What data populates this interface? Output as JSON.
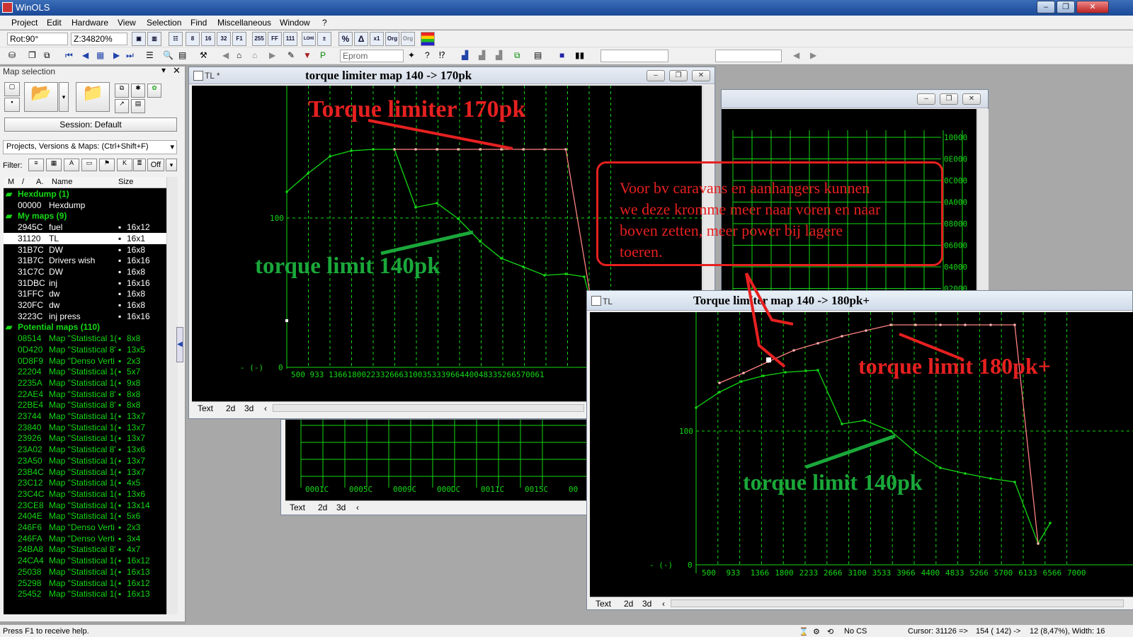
{
  "app": {
    "title": "WinOLS"
  },
  "menu": [
    "Project",
    "Edit",
    "Hardware",
    "View",
    "Selection",
    "Find",
    "Miscellaneous",
    "Window",
    "?"
  ],
  "toolbar": {
    "rot": "Rot:90°",
    "zoom": "Z:34820%",
    "eprom_label": "Eprom",
    "tb_255": "255",
    "tb_ff": "FF",
    "tb_32": "32",
    "tb_f1": "F1",
    "tb_8": "8",
    "tb_16": "16",
    "tb_111": "111",
    "tb_lohi": "LOHI",
    "tb_hilo": "HILO",
    "tb_pct": "%",
    "tb_x1": "x1",
    "tb_org": "Org",
    "tb_org2": "Org"
  },
  "panel": {
    "title": "Map selection",
    "session": "Session: Default",
    "projects_dropdown": "Projects, Versions & Maps: (Ctrl+Shift+F)",
    "filter_label": "Filter:",
    "filter_off": "Off",
    "col_m": "M",
    "col_slash": "/",
    "col_a": "A.",
    "col_name": "Name",
    "col_size": "Size"
  },
  "maplist": [
    {
      "addr": "Hexdump (1)",
      "name": "",
      "size": "",
      "kind": "hdr"
    },
    {
      "addr": "00000",
      "name": "Hexdump",
      "size": "",
      "kind": "white"
    },
    {
      "addr": "My maps (9)",
      "name": "",
      "size": "",
      "kind": "hdr"
    },
    {
      "addr": "2945C",
      "name": "fuel",
      "size": "16x12",
      "kind": "white"
    },
    {
      "addr": "31120",
      "name": "TL",
      "size": "16x1",
      "kind": "sel"
    },
    {
      "addr": "31B7C",
      "name": "DW",
      "size": "16x8",
      "kind": "white"
    },
    {
      "addr": "31B7C",
      "name": "Drivers wish",
      "size": "16x16",
      "kind": "white"
    },
    {
      "addr": "31C7C",
      "name": "DW",
      "size": "16x8",
      "kind": "white"
    },
    {
      "addr": "31DBC",
      "name": "inj",
      "size": "16x16",
      "kind": "white"
    },
    {
      "addr": "31FFC",
      "name": "dw",
      "size": "16x8",
      "kind": "white"
    },
    {
      "addr": "320FC",
      "name": "dw",
      "size": "16x8",
      "kind": "white"
    },
    {
      "addr": "3223C",
      "name": "inj press",
      "size": "16x16",
      "kind": "white"
    },
    {
      "addr": "Potential maps (110)",
      "name": "",
      "size": "",
      "kind": "hdr"
    },
    {
      "addr": "08514",
      "name": "Map \"Statistical 1(",
      "size": "8x8",
      "kind": "green"
    },
    {
      "addr": "0D420",
      "name": "Map \"Statistical 8'",
      "size": "13x5",
      "kind": "green"
    },
    {
      "addr": "0D8F9",
      "name": "Map \"Denso Verti",
      "size": "2x3",
      "kind": "green"
    },
    {
      "addr": "22204",
      "name": "Map \"Statistical 1(",
      "size": "5x7",
      "kind": "green"
    },
    {
      "addr": "2235A",
      "name": "Map \"Statistical 1(",
      "size": "9x8",
      "kind": "green"
    },
    {
      "addr": "22AE4",
      "name": "Map \"Statistical 8'",
      "size": "8x8",
      "kind": "green"
    },
    {
      "addr": "22BE4",
      "name": "Map \"Statistical 8'",
      "size": "8x8",
      "kind": "green"
    },
    {
      "addr": "23744",
      "name": "Map \"Statistical 1(",
      "size": "13x7",
      "kind": "green"
    },
    {
      "addr": "23840",
      "name": "Map \"Statistical 1(",
      "size": "13x7",
      "kind": "green"
    },
    {
      "addr": "23926",
      "name": "Map \"Statistical 1(",
      "size": "13x7",
      "kind": "green"
    },
    {
      "addr": "23A02",
      "name": "Map \"Statistical 8'",
      "size": "13x6",
      "kind": "green"
    },
    {
      "addr": "23A50",
      "name": "Map \"Statistical 1(",
      "size": "13x7",
      "kind": "green"
    },
    {
      "addr": "23B4C",
      "name": "Map \"Statistical 1(",
      "size": "13x7",
      "kind": "green"
    },
    {
      "addr": "23C12",
      "name": "Map \"Statistical 1(",
      "size": "4x5",
      "kind": "green"
    },
    {
      "addr": "23C4C",
      "name": "Map \"Statistical 1(",
      "size": "13x6",
      "kind": "green"
    },
    {
      "addr": "23CE8",
      "name": "Map \"Statistical 1(",
      "size": "13x14",
      "kind": "green"
    },
    {
      "addr": "2404E",
      "name": "Map \"Statistical 1(",
      "size": "5x6",
      "kind": "green"
    },
    {
      "addr": "246F6",
      "name": "Map \"Denso Verti",
      "size": "2x3",
      "kind": "green"
    },
    {
      "addr": "246FA",
      "name": "Map \"Denso Verti",
      "size": "3x4",
      "kind": "green"
    },
    {
      "addr": "24BA8",
      "name": "Map \"Statistical 8'",
      "size": "4x7",
      "kind": "green"
    },
    {
      "addr": "24CA4",
      "name": "Map \"Statistical 1(",
      "size": "16x12",
      "kind": "green"
    },
    {
      "addr": "25038",
      "name": "Map \"Statistical 1(",
      "size": "16x13",
      "kind": "green"
    },
    {
      "addr": "25298",
      "name": "Map \"Statistical 1(",
      "size": "16x12",
      "kind": "green"
    },
    {
      "addr": "25452",
      "name": "Map \"Statistical 1(",
      "size": "16x13",
      "kind": "green"
    }
  ],
  "win1": {
    "tag": "TL *",
    "title": "torque limiter map 140 -> 170pk",
    "tab_text": "Text",
    "tab_2d": "2d",
    "tab_3d": "3d",
    "y_label": "100",
    "y_zero": "0",
    "y_unit": "- (-)",
    "x_label": "500  933  1366180022332666310035333966440048335266570061",
    "annot_170": "Torque limiter 170pk",
    "annot_140": "torque limit 140pk"
  },
  "win_bottom": {
    "tab_text": "Text",
    "tab_2d": "2d",
    "tab_3d": "3d",
    "x_labels": [
      "0001C",
      "0005C",
      "0009C",
      "000DC",
      "0011C",
      "0015C",
      "00"
    ]
  },
  "win_back": {
    "y_labels": [
      "10000",
      "0E000",
      "0C000",
      "0A000",
      "08000",
      "06000",
      "04000",
      "02000"
    ]
  },
  "win2": {
    "tag": "TL",
    "title": "Torque limiter map 140 -> 180pk+",
    "tab_text": "Text",
    "tab_2d": "2d",
    "tab_3d": "3d",
    "y_label": "100",
    "y_zero": "0",
    "y_unit": "- (-)",
    "x_labels": [
      "500",
      "933",
      "1366",
      "1800",
      "2233",
      "2666",
      "3100",
      "3533",
      "3966",
      "4400",
      "4833",
      "5266",
      "5700",
      "6133",
      "6566",
      "7000"
    ],
    "annot_180": "torque limit 180pk+",
    "annot_140": "torque limit 140pk"
  },
  "callout": {
    "line1": "Voor bv caravans en aanhangers kunnen",
    "line2": "we deze kromme meer naar voren en naar",
    "line3": "boven zetten, meer power bij lagere",
    "line4": "toeren."
  },
  "status": {
    "help": "Press F1 to receive help.",
    "cs": "No CS",
    "cursor": "Cursor: 31126 =>",
    "pos": "154 ( 142) ->",
    "width": "12 (8,47%), Width: 16"
  },
  "colors": {
    "green": "#14d814",
    "red": "#ff1a1a",
    "pink": "#ff8080",
    "annot_red": "#e62020",
    "annot_green": "#1aa83a"
  }
}
